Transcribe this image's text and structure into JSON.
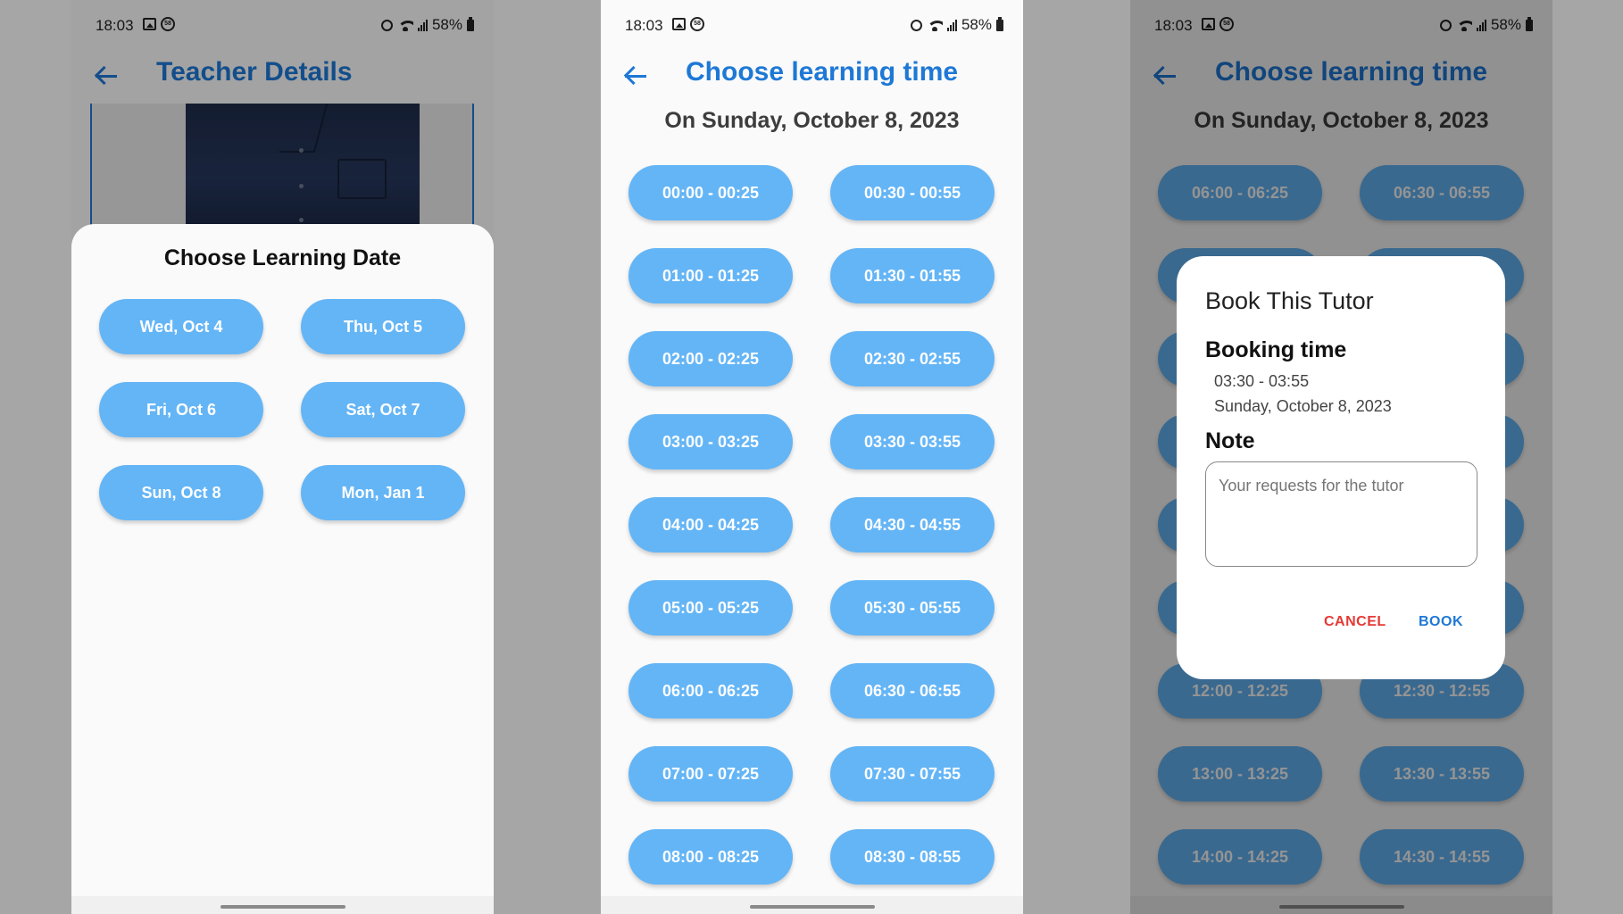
{
  "status": {
    "time": "18:03",
    "notif_badge": "58",
    "battery": "58%"
  },
  "screen1": {
    "title": "Teacher Details",
    "sheet_title": "Choose Learning Date",
    "dates": [
      {
        "label": "Wed, Oct 4"
      },
      {
        "label": "Thu, Oct 5"
      },
      {
        "label": "Fri, Oct 6"
      },
      {
        "label": "Sat, Oct 7"
      },
      {
        "label": "Sun, Oct 8"
      },
      {
        "label": "Mon, Jan 1"
      }
    ]
  },
  "screen2": {
    "title": "Choose learning time",
    "date_heading": "On Sunday, October 8, 2023",
    "slots": [
      {
        "label": "00:00 - 00:25"
      },
      {
        "label": "00:30 - 00:55"
      },
      {
        "label": "01:00 - 01:25"
      },
      {
        "label": "01:30 - 01:55"
      },
      {
        "label": "02:00 - 02:25"
      },
      {
        "label": "02:30 - 02:55"
      },
      {
        "label": "03:00 - 03:25"
      },
      {
        "label": "03:30 - 03:55"
      },
      {
        "label": "04:00 - 04:25"
      },
      {
        "label": "04:30 - 04:55"
      },
      {
        "label": "05:00 - 05:25"
      },
      {
        "label": "05:30 - 05:55"
      },
      {
        "label": "06:00 - 06:25"
      },
      {
        "label": "06:30 - 06:55"
      },
      {
        "label": "07:00 - 07:25"
      },
      {
        "label": "07:30 - 07:55"
      },
      {
        "label": "08:00 - 08:25"
      },
      {
        "label": "08:30 - 08:55"
      }
    ]
  },
  "screen3": {
    "title": "Choose learning time",
    "date_heading": "On Sunday, October 8, 2023",
    "slots": [
      {
        "label": "06:00 - 06:25"
      },
      {
        "label": "06:30 - 06:55"
      },
      {
        "label": ""
      },
      {
        "label": ""
      },
      {
        "label": ""
      },
      {
        "label": ""
      },
      {
        "label": ""
      },
      {
        "label": ""
      },
      {
        "label": ""
      },
      {
        "label": ""
      },
      {
        "label": ""
      },
      {
        "label": ""
      },
      {
        "label": "12:00 - 12:25"
      },
      {
        "label": "12:30 - 12:55"
      },
      {
        "label": "13:00 - 13:25"
      },
      {
        "label": "13:30 - 13:55"
      },
      {
        "label": "14:00 - 14:25"
      },
      {
        "label": "14:30 - 14:55"
      }
    ],
    "dialog": {
      "title": "Book This Tutor",
      "booking_time_label": "Booking time",
      "booking_time": "03:30 - 03:55",
      "booking_date": "Sunday, October 8, 2023",
      "note_label": "Note",
      "note_placeholder": "Your requests for the tutor",
      "cancel_label": "CANCEL",
      "book_label": "BOOK"
    }
  },
  "colors": {
    "accent": "#1e78d6",
    "pill": "#64b5f6",
    "cancel": "#e53935",
    "background": "#a6a6a6"
  },
  "icons": [
    "back-arrow-icon",
    "gallery-icon",
    "notification-count-icon",
    "alarm-icon",
    "wifi-icon",
    "signal-icon",
    "battery-icon"
  ]
}
